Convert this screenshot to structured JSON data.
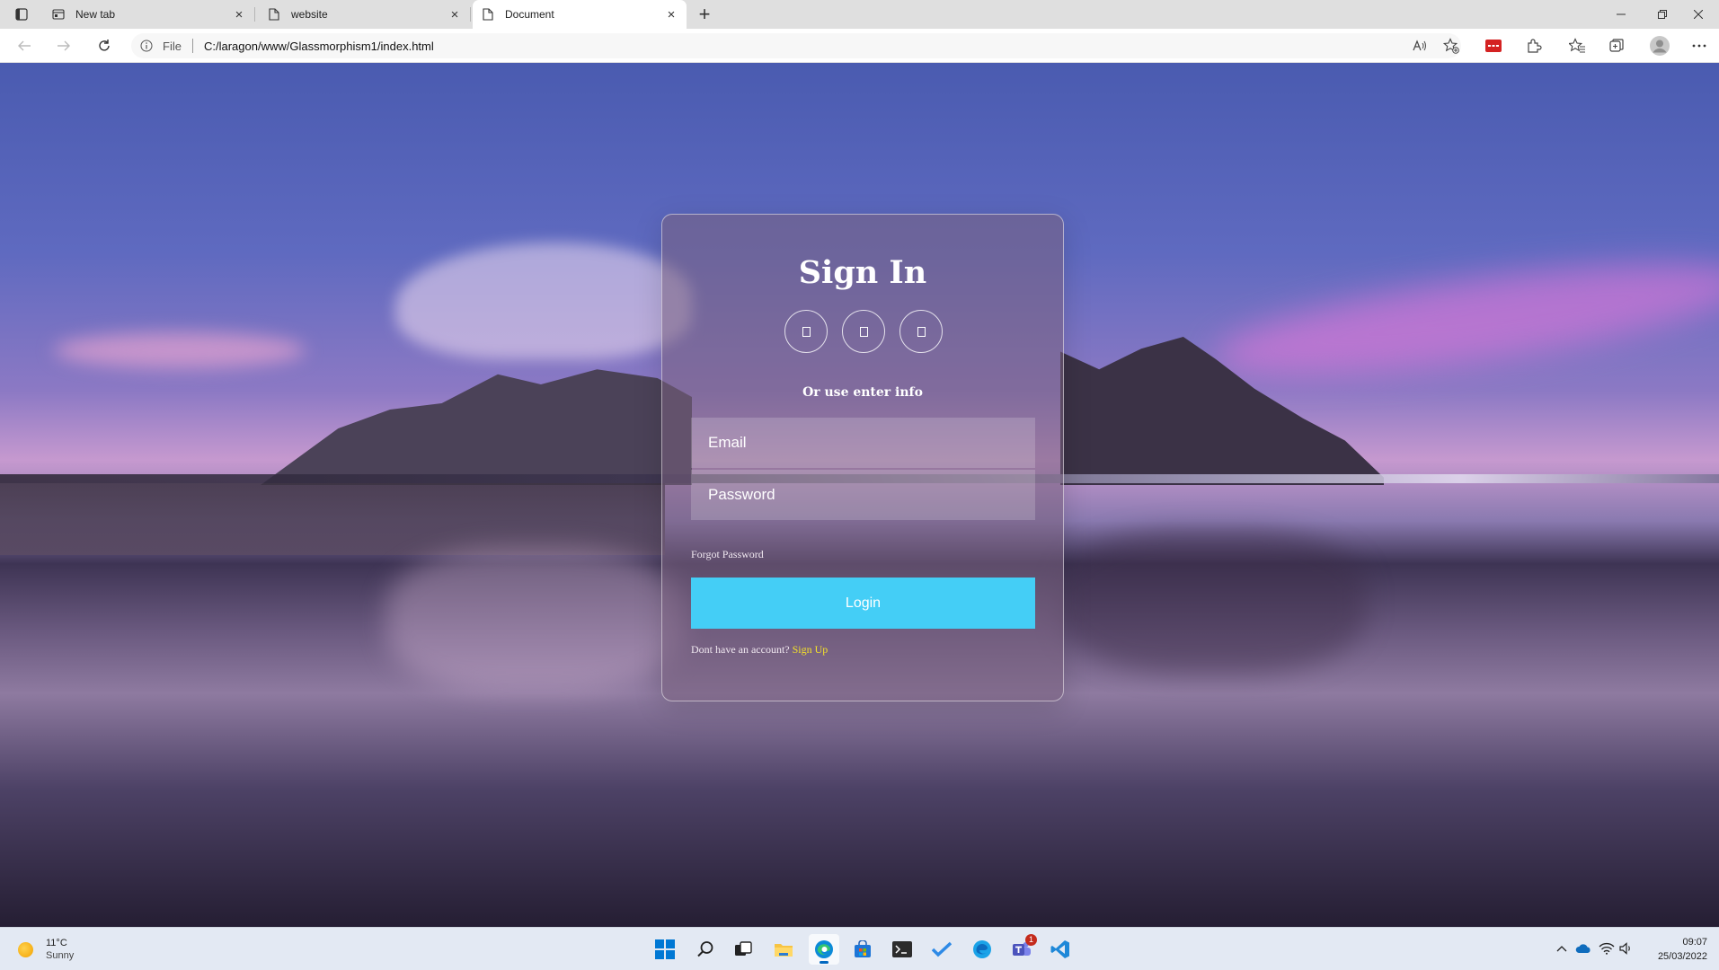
{
  "browser": {
    "tabs": [
      {
        "label": "New tab",
        "active": false
      },
      {
        "label": "website",
        "active": false
      },
      {
        "label": "Document",
        "active": true
      }
    ],
    "address": {
      "label": "File",
      "url": "C:/laragon/www/Glassmorphism1/index.html"
    }
  },
  "login": {
    "title": "Sign In",
    "alt_text": "Or use enter info",
    "social_icons": [
      "missing-glyph-icon",
      "missing-glyph-icon",
      "missing-glyph-icon"
    ],
    "email_placeholder": "Email",
    "password_placeholder": "Password",
    "forgot_label": "Forgot Password",
    "login_label": "Login",
    "signup_prompt": "Dont have an account?",
    "signup_link": "Sign Up",
    "accent_color": "#44cef6",
    "link_color": "#f4e12a"
  },
  "taskbar": {
    "weather": {
      "temp": "11°C",
      "condition": "Sunny"
    },
    "teams_badge": "1",
    "clock": {
      "time": "09:07",
      "date": "25/03/2022"
    }
  }
}
